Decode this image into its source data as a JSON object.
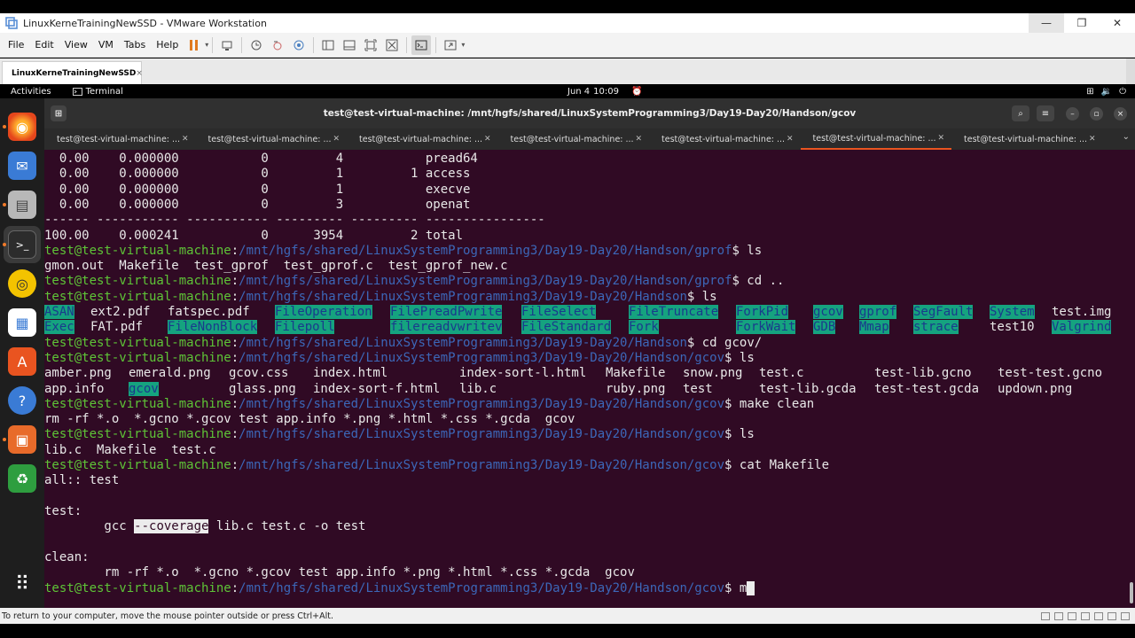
{
  "window": {
    "title": "LinuxKerneTrainingNewSSD - VMware Workstation",
    "minimize": "—",
    "maximize": "❐",
    "close": "✕"
  },
  "menu": {
    "items": [
      "File",
      "Edit",
      "View",
      "VM",
      "Tabs",
      "Help"
    ]
  },
  "vm_tab": {
    "label": "LinuxKerneTrainingNewSSD",
    "close": "×"
  },
  "topbar": {
    "activities": "Activities",
    "app": "Terminal",
    "date": "Jun 4",
    "time": "10:09"
  },
  "terminal": {
    "title": "test@test-virtual-machine: /mnt/hgfs/shared/LinuxSystemProgramming3/Day19-Day20/Handson/gcov",
    "tabs": [
      "test@test-virtual-machine: ...",
      "test@test-virtual-machine: ...",
      "test@test-virtual-machine: ...",
      "test@test-virtual-machine: ...",
      "test@test-virtual-machine: ...",
      "test@test-virtual-machine: ...",
      "test@test-virtual-machine: ..."
    ],
    "active_tab": 5,
    "prompt_user": "test@test-virtual-machine",
    "path_gprof": "/mnt/hgfs/shared/LinuxSystemProgramming3/Day19-Day20/Handson/gprof",
    "path_handson": "/mnt/hgfs/shared/LinuxSystemProgramming3/Day19-Day20/Handson",
    "path_gcov": "/mnt/hgfs/shared/LinuxSystemProgramming3/Day19-Day20/Handson/gcov",
    "strace_rows": [
      "  0.00    0.000000           0         4           pread64",
      "  0.00    0.000000           0         1         1 access",
      "  0.00    0.000000           0         1           execve",
      "  0.00    0.000000           0         3           openat"
    ],
    "strace_sep": "------ ----------- ----------- --------- --------- ----------------",
    "strace_total": "100.00    0.000241           0      3954         2 total",
    "cmd_ls": "$ ls",
    "gprof_files": "gmon.out  Makefile  test_gprof  test_gprof.c  test_gprof_new.c",
    "cmd_cd_up": "$ cd ..",
    "handson_row1": [
      "ASAN",
      "ext2.pdf",
      "fatspec.pdf",
      "FileOperation",
      "FilePreadPwrite",
      "FileSelect",
      "FileTruncate",
      "ForkPid",
      "gcov",
      "gprof",
      "SegFault",
      "System",
      "test.img"
    ],
    "handson_row2": [
      "Exec",
      "FAT.pdf",
      "FileNonBlock",
      "Filepoll",
      "filereadvwritev",
      "FileStandard",
      "Fork",
      "ForkWait",
      "GDB",
      "Mmap",
      "strace",
      "test10",
      "Valgrind"
    ],
    "cmd_cd_gcov": "$ cd gcov/",
    "gcov_row1": [
      "amber.png",
      "emerald.png",
      "gcov.css",
      "index.html",
      "index-sort-l.html",
      "Makefile",
      "snow.png",
      "test.c",
      "test-lib.gcno",
      "test-test.gcno"
    ],
    "gcov_row2": [
      "app.info",
      "gcov",
      "glass.png",
      "index-sort-f.html",
      "lib.c",
      "ruby.png",
      "test",
      "test-lib.gcda",
      "test-test.gcda",
      "updown.png"
    ],
    "cmd_make_clean": "$ make clean",
    "clean_out": "rm -rf *.o  *.gcno *.gcov test app.info *.png *.html *.css *.gcda  gcov",
    "after_clean": "lib.c  Makefile  test.c",
    "cmd_cat": "$ cat Makefile",
    "mk_all": "all:: test",
    "mk_test": "test:",
    "mk_gcc_pre": "        gcc ",
    "mk_gcc_flag": "--coverage",
    "mk_gcc_post": " lib.c test.c -o test",
    "mk_clean": "clean:",
    "mk_rm": "        rm -rf *.o  *.gcno *.gcov test app.info *.png *.html *.css *.gcda  gcov",
    "cmd_typing": "$ ",
    "cursor_char": "m"
  },
  "status": {
    "hint": "To return to your computer, move the mouse pointer outside or press Ctrl+Alt."
  },
  "colors": {
    "terminal_bg": "#300a24",
    "prompt_user": "#5ec437",
    "prompt_path": "#3c67b8",
    "dir_highlight": "#15a37f",
    "accent": "#e95420"
  }
}
